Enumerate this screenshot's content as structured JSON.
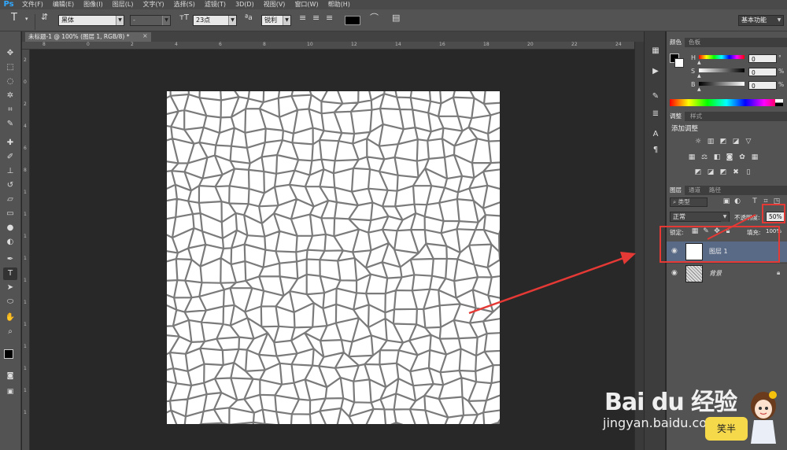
{
  "app": {
    "logo": "Ps"
  },
  "menu": [
    "文件(F)",
    "编辑(E)",
    "图像(I)",
    "图层(L)",
    "文字(Y)",
    "选择(S)",
    "滤镜(T)",
    "3D(D)",
    "视图(V)",
    "窗口(W)",
    "帮助(H)"
  ],
  "options_bar": {
    "tool_glyph": "T",
    "font_family": "黑体",
    "font_style": "-",
    "font_size": "23点",
    "antialias": "锐利",
    "workspace": "基本功能"
  },
  "document": {
    "tab_title": "未标题-1 @ 100% (图层 1, RGB/8) *",
    "close_glyph": "×"
  },
  "ruler_top": [
    "8",
    "0",
    "2",
    "4",
    "6",
    "8",
    "10",
    "12",
    "14",
    "16",
    "18",
    "20",
    "22",
    "24"
  ],
  "ruler_left": [
    "2",
    "0",
    "2",
    "4",
    "6",
    "8",
    "1",
    "1",
    "1",
    "1",
    "1",
    "1",
    "1",
    "1",
    "1",
    "1",
    "1"
  ],
  "color_panel": {
    "tabs": [
      "颜色",
      "色板"
    ],
    "h_label": "H",
    "s_label": "S",
    "b_label": "B",
    "h_value": "0",
    "s_value": "0",
    "b_value": "0",
    "unit_deg": "°",
    "unit_pct": "%",
    "h_level": 0,
    "s_level": 0,
    "b_level": 0
  },
  "adjust_panel": {
    "tabs": [
      "调整",
      "样式"
    ],
    "heading": "添加调整"
  },
  "layers_panel": {
    "tabs": [
      "图层",
      "通道",
      "路径"
    ],
    "filter_kind": "类型",
    "blend_mode": "正常",
    "opacity_label": "不透明度:",
    "opacity_value": "50%",
    "lock_label": "锁定:",
    "fill_label": "填充:",
    "fill_value": "100%",
    "layers": [
      {
        "name": "图层 1",
        "selected": true
      },
      {
        "name": "背景",
        "selected": false
      }
    ]
  },
  "watermark": {
    "brand": "Bai du 经验",
    "url": "jingyan.baidu.com",
    "badge": "笑半"
  },
  "colors": {
    "accent": "#31a8ff",
    "annotation": "#e53935",
    "canvas_bg": "#282828",
    "panel_bg": "#535353",
    "pattern_stroke": "#7a7a7a"
  }
}
